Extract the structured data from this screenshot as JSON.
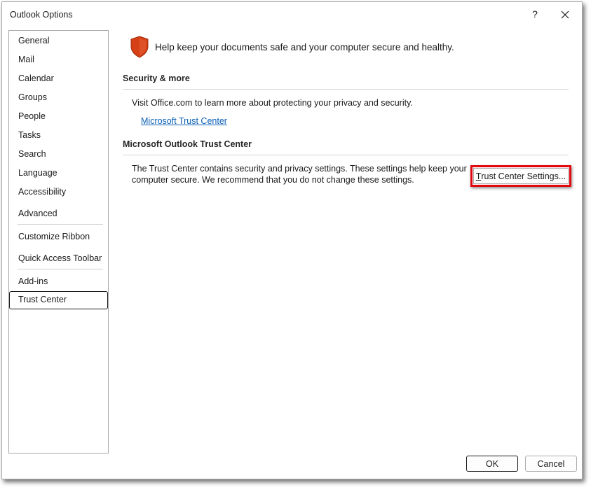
{
  "window": {
    "title": "Outlook Options",
    "help_label": "?",
    "close_icon": "close-icon"
  },
  "sidebar": {
    "items": [
      {
        "label": "General"
      },
      {
        "label": "Mail"
      },
      {
        "label": "Calendar"
      },
      {
        "label": "Groups"
      },
      {
        "label": "People"
      },
      {
        "label": "Tasks"
      },
      {
        "label": "Search"
      },
      {
        "label": "Language"
      },
      {
        "label": "Accessibility"
      },
      {
        "label": "Advanced"
      },
      {
        "label": "Customize Ribbon"
      },
      {
        "label": "Quick Access Toolbar"
      },
      {
        "label": "Add-ins"
      },
      {
        "label": "Trust Center"
      }
    ],
    "selected": "Trust Center"
  },
  "main": {
    "header_text": "Help keep your documents safe and your computer secure and healthy.",
    "shield_icon": "shield-icon",
    "shield_color": "#d64016",
    "security_section": {
      "title": "Security & more",
      "description": "Visit Office.com to learn more about protecting your privacy and security.",
      "link_label": "Microsoft Trust Center"
    },
    "trust_center_section": {
      "title": "Microsoft Outlook Trust Center",
      "description_line1": "The Trust Center contains security and privacy settings. These settings help keep your",
      "description_line2": "computer secure. We recommend that you do not change these settings.",
      "button_mnemonic": "T",
      "button_rest": "rust Center Settings..."
    }
  },
  "footer": {
    "ok_label": "OK",
    "cancel_label": "Cancel"
  },
  "colors": {
    "link": "#0a5fb4",
    "highlight": "#e0070f"
  }
}
